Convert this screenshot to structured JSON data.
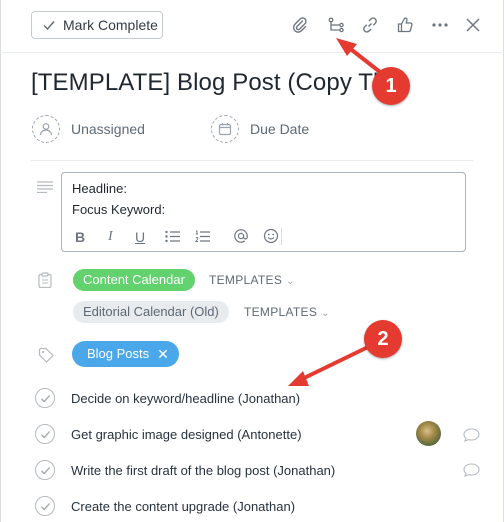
{
  "toolbar": {
    "mark_complete_label": "Mark Complete",
    "icons": [
      "paperclip-icon",
      "subtask-icon",
      "link-icon",
      "thumbs-up-icon",
      "more-icon",
      "close-icon"
    ]
  },
  "task": {
    "title": "[TEMPLATE] Blog Post (Copy Th"
  },
  "fields": {
    "assignee_label": "Unassigned",
    "due_date_label": "Due Date"
  },
  "description": {
    "lines": [
      "Headline:",
      "Focus Keyword:"
    ],
    "format_buttons": [
      "B",
      "I",
      "U"
    ]
  },
  "projects": [
    {
      "name": "Content Calendar",
      "section": "TEMPLATES",
      "color": "#62d26f"
    },
    {
      "name": "Editorial Calendar (Old)",
      "section": "TEMPLATES",
      "color": "#e8ebed"
    }
  ],
  "tags": [
    {
      "name": "Blog Posts",
      "color": "#4aa8ea"
    }
  ],
  "subtasks": [
    {
      "label": "Decide on keyword/headline (Jonathan)",
      "has_avatar": false,
      "has_comment": false
    },
    {
      "label": "Get graphic image designed (Antonette)",
      "has_avatar": true,
      "has_comment": true
    },
    {
      "label": "Write the first draft of the blog post (Jonathan)",
      "has_avatar": false,
      "has_comment": true
    },
    {
      "label": "Create the content upgrade (Jonathan)",
      "has_avatar": false,
      "has_comment": false
    }
  ],
  "annotations": [
    {
      "number": "1",
      "color": "#e53a2f"
    },
    {
      "number": "2",
      "color": "#e53a2f"
    }
  ]
}
